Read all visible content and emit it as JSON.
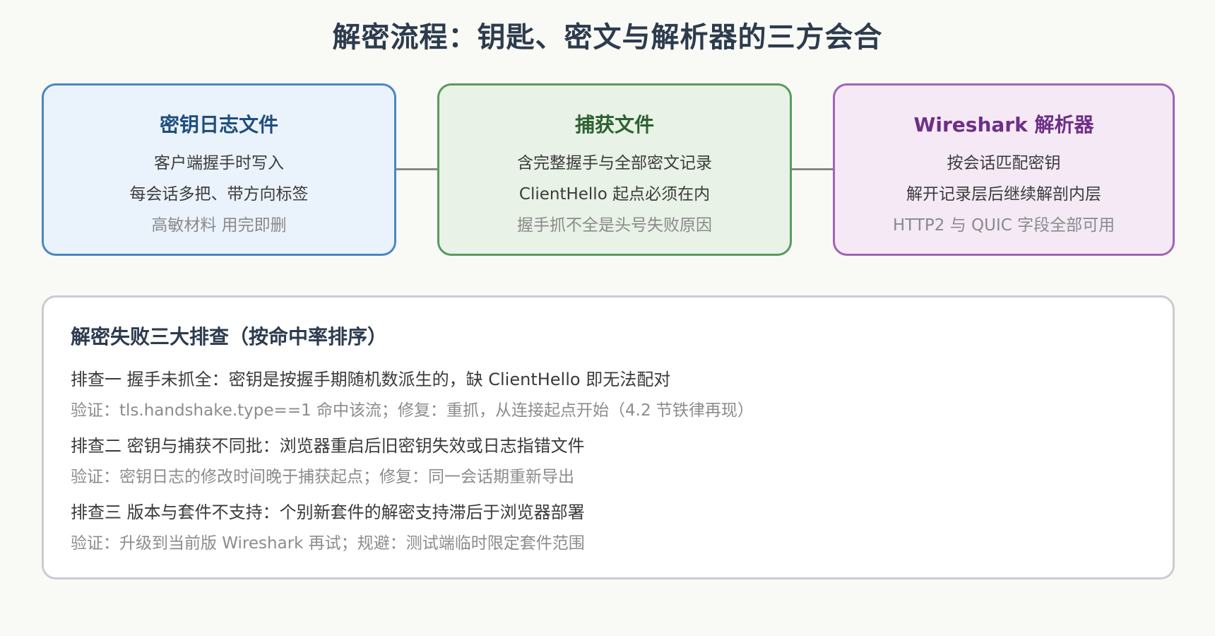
{
  "title": "解密流程：钥匙、密文与解析器的三方会合",
  "cards": [
    {
      "title": "密钥日志文件",
      "line1": "客户端握手时写入",
      "line2": "每会话多把、带方向标签",
      "line3": "高敏材料 用完即删"
    },
    {
      "title": "捕获文件",
      "line1": "含完整握手与全部密文记录",
      "line2": "ClientHello 起点必须在内",
      "line3": "握手抓不全是头号失败原因"
    },
    {
      "title": "Wireshark 解析器",
      "line1": "按会话匹配密钥",
      "line2": "解开记录层后继续解剖内层",
      "line3": "HTTP2 与 QUIC 字段全部可用"
    }
  ],
  "panel": {
    "title": "解密失败三大排查（按命中率排序）",
    "items": [
      {
        "main": "排查一 握手未抓全：密钥是按握手期随机数派生的，缺 ClientHello 即无法配对",
        "sub": "验证：tls.handshake.type==1 命中该流；修复：重抓，从连接起点开始（4.2 节铁律再现）"
      },
      {
        "main": "排查二 密钥与捕获不同批：浏览器重启后旧密钥失效或日志指错文件",
        "sub": "验证：密钥日志的修改时间晚于捕获起点；修复：同一会话期重新导出"
      },
      {
        "main": "排查三 版本与套件不支持：个别新套件的解密支持滞后于浏览器部署",
        "sub": "验证：升级到当前版 Wireshark 再试；规避：测试端临时限定套件范围"
      }
    ]
  }
}
